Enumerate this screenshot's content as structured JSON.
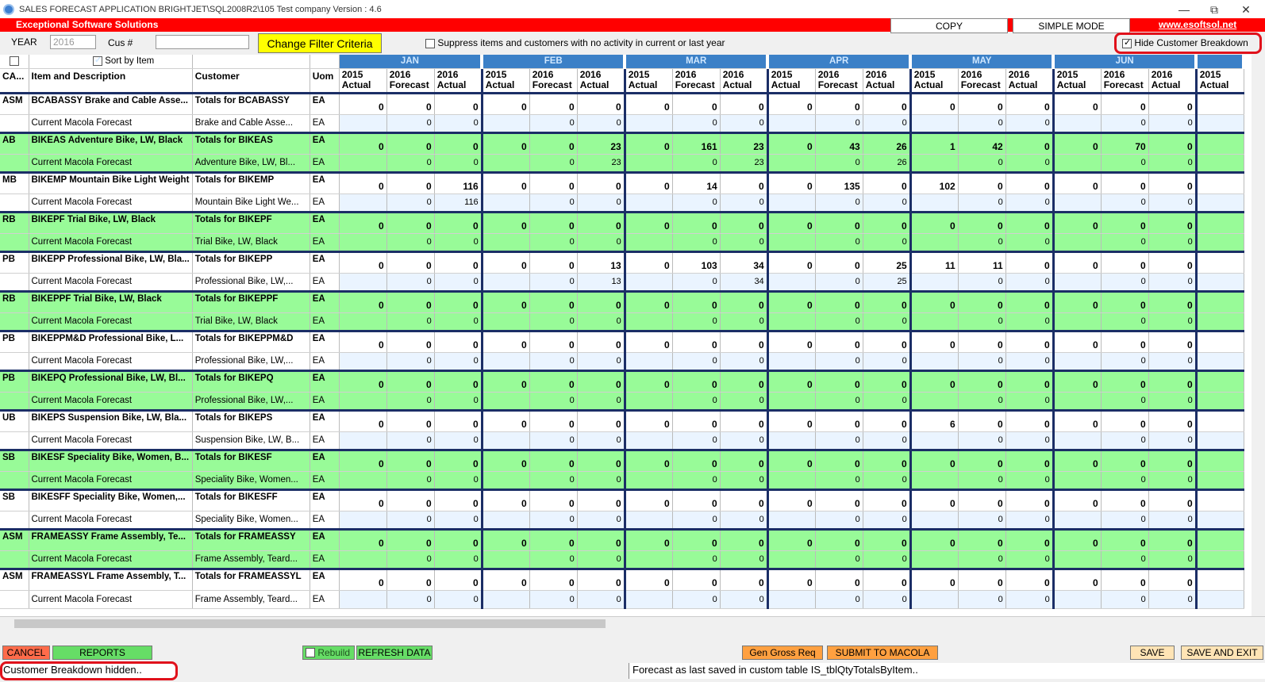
{
  "window": {
    "title": "SALES FORECAST APPLICATION  BRIGHTJET\\SQL2008R2\\105     Test company  Version : 4.6",
    "controls": [
      "—",
      "⧉",
      "✕"
    ]
  },
  "header": {
    "brand": "Exceptional Software Solutions",
    "copy_label": "COPY",
    "simple_mode_label": "SIMPLE MODE",
    "url": "www.esoftsol.net",
    "brand_color": "#ff0000"
  },
  "filters": {
    "year_label": "YEAR",
    "year_value": "2016",
    "cus_label": "Cus #",
    "cus_value": "",
    "change_filter_label": "Change Filter Criteria",
    "suppress_label": "Suppress items and customers with no activity in current or last year",
    "hide_breakdown_label": "Hide Customer Breakdown"
  },
  "grid": {
    "sort_label": "Sort by Item",
    "months": [
      "JAN",
      "FEB",
      "MAR",
      "APR",
      "MAY",
      "JUN"
    ],
    "col_headers": [
      "CA...",
      "Item and Description",
      "Customer",
      "Uom"
    ],
    "sub_headers": [
      "2015 Actual",
      "2016 Forecast",
      "2016 Actual"
    ],
    "last_sub_header": "2015 Actual",
    "fc_desc": "Current Macola Forecast",
    "rows": [
      {
        "ca": "ASM",
        "item": "BCABASSY Brake and Cable Asse...",
        "cust": "Totals for BCABASSY",
        "fcust": "Brake and Cable Asse...",
        "uom": "EA",
        "green": false,
        "t": [
          "0",
          "0",
          "0",
          "0",
          "0",
          "0",
          "0",
          "0",
          "0",
          "0",
          "0",
          "0",
          "0",
          "0",
          "0",
          "0",
          "0",
          "0"
        ],
        "f": [
          "",
          "0",
          "0",
          "",
          "0",
          "0",
          "",
          "0",
          "0",
          "",
          "0",
          "0",
          "",
          "0",
          "0",
          "",
          "0",
          "0"
        ]
      },
      {
        "ca": "AB",
        "item": "BIKEAS Adventure Bike, LW, Black",
        "cust": "Totals for BIKEAS",
        "fcust": "Adventure Bike, LW, Bl...",
        "uom": "EA",
        "green": true,
        "t": [
          "0",
          "0",
          "0",
          "0",
          "0",
          "23",
          "0",
          "161",
          "23",
          "0",
          "43",
          "26",
          "1",
          "42",
          "0",
          "0",
          "70",
          "0"
        ],
        "f": [
          "",
          "0",
          "0",
          "",
          "0",
          "23",
          "",
          "0",
          "23",
          "",
          "0",
          "26",
          "",
          "0",
          "0",
          "",
          "0",
          "0"
        ]
      },
      {
        "ca": "MB",
        "item": "BIKEMP Mountain Bike Light Weight",
        "cust": "Totals for BIKEMP",
        "fcust": "Mountain Bike Light We...",
        "uom": "EA",
        "green": false,
        "t": [
          "0",
          "0",
          "116",
          "0",
          "0",
          "0",
          "0",
          "14",
          "0",
          "0",
          "135",
          "0",
          "102",
          "0",
          "0",
          "0",
          "0",
          "0"
        ],
        "f": [
          "",
          "0",
          "116",
          "",
          "0",
          "0",
          "",
          "0",
          "0",
          "",
          "0",
          "0",
          "",
          "0",
          "0",
          "",
          "0",
          "0"
        ]
      },
      {
        "ca": "RB",
        "item": "BIKEPF Trial Bike, LW, Black",
        "cust": "Totals for BIKEPF",
        "fcust": "Trial Bike, LW, Black",
        "uom": "EA",
        "green": true,
        "t": [
          "0",
          "0",
          "0",
          "0",
          "0",
          "0",
          "0",
          "0",
          "0",
          "0",
          "0",
          "0",
          "0",
          "0",
          "0",
          "0",
          "0",
          "0"
        ],
        "f": [
          "",
          "0",
          "0",
          "",
          "0",
          "0",
          "",
          "0",
          "0",
          "",
          "0",
          "0",
          "",
          "0",
          "0",
          "",
          "0",
          "0"
        ]
      },
      {
        "ca": "PB",
        "item": "BIKEPP Professional Bike, LW, Bla...",
        "cust": "Totals for BIKEPP",
        "fcust": "Professional Bike, LW,...",
        "uom": "EA",
        "green": false,
        "t": [
          "0",
          "0",
          "0",
          "0",
          "0",
          "13",
          "0",
          "103",
          "34",
          "0",
          "0",
          "25",
          "11",
          "11",
          "0",
          "0",
          "0",
          "0"
        ],
        "f": [
          "",
          "0",
          "0",
          "",
          "0",
          "13",
          "",
          "0",
          "34",
          "",
          "0",
          "25",
          "",
          "0",
          "0",
          "",
          "0",
          "0"
        ]
      },
      {
        "ca": "RB",
        "item": "BIKEPPF Trial Bike, LW, Black",
        "cust": "Totals for BIKEPPF",
        "fcust": "Trial Bike, LW, Black",
        "uom": "EA",
        "green": true,
        "t": [
          "0",
          "0",
          "0",
          "0",
          "0",
          "0",
          "0",
          "0",
          "0",
          "0",
          "0",
          "0",
          "0",
          "0",
          "0",
          "0",
          "0",
          "0"
        ],
        "f": [
          "",
          "0",
          "0",
          "",
          "0",
          "0",
          "",
          "0",
          "0",
          "",
          "0",
          "0",
          "",
          "0",
          "0",
          "",
          "0",
          "0"
        ]
      },
      {
        "ca": "PB",
        "item": "BIKEPPM&D Professional Bike, L...",
        "cust": "Totals for BIKEPPM&D",
        "fcust": "Professional Bike, LW,...",
        "uom": "EA",
        "green": false,
        "t": [
          "0",
          "0",
          "0",
          "0",
          "0",
          "0",
          "0",
          "0",
          "0",
          "0",
          "0",
          "0",
          "0",
          "0",
          "0",
          "0",
          "0",
          "0"
        ],
        "f": [
          "",
          "0",
          "0",
          "",
          "0",
          "0",
          "",
          "0",
          "0",
          "",
          "0",
          "0",
          "",
          "0",
          "0",
          "",
          "0",
          "0"
        ]
      },
      {
        "ca": "PB",
        "item": "BIKEPQ Professional Bike, LW, Bl...",
        "cust": "Totals for BIKEPQ",
        "fcust": "Professional Bike, LW,...",
        "uom": "EA",
        "green": true,
        "t": [
          "0",
          "0",
          "0",
          "0",
          "0",
          "0",
          "0",
          "0",
          "0",
          "0",
          "0",
          "0",
          "0",
          "0",
          "0",
          "0",
          "0",
          "0"
        ],
        "f": [
          "",
          "0",
          "0",
          "",
          "0",
          "0",
          "",
          "0",
          "0",
          "",
          "0",
          "0",
          "",
          "0",
          "0",
          "",
          "0",
          "0"
        ]
      },
      {
        "ca": "UB",
        "item": "BIKEPS Suspension Bike, LW, Bla...",
        "cust": "Totals for BIKEPS",
        "fcust": "Suspension Bike, LW, B...",
        "uom": "EA",
        "green": false,
        "t": [
          "0",
          "0",
          "0",
          "0",
          "0",
          "0",
          "0",
          "0",
          "0",
          "0",
          "0",
          "0",
          "6",
          "0",
          "0",
          "0",
          "0",
          "0"
        ],
        "f": [
          "",
          "0",
          "0",
          "",
          "0",
          "0",
          "",
          "0",
          "0",
          "",
          "0",
          "0",
          "",
          "0",
          "0",
          "",
          "0",
          "0"
        ]
      },
      {
        "ca": "SB",
        "item": "BIKESF Speciality Bike, Women, B...",
        "cust": "Totals for BIKESF",
        "fcust": "Speciality Bike, Women...",
        "uom": "EA",
        "green": true,
        "t": [
          "0",
          "0",
          "0",
          "0",
          "0",
          "0",
          "0",
          "0",
          "0",
          "0",
          "0",
          "0",
          "0",
          "0",
          "0",
          "0",
          "0",
          "0"
        ],
        "f": [
          "",
          "0",
          "0",
          "",
          "0",
          "0",
          "",
          "0",
          "0",
          "",
          "0",
          "0",
          "",
          "0",
          "0",
          "",
          "0",
          "0"
        ]
      },
      {
        "ca": "SB",
        "item": "BIKESFF Speciality Bike, Women,...",
        "cust": "Totals for BIKESFF",
        "fcust": "Speciality Bike, Women...",
        "uom": "EA",
        "green": false,
        "t": [
          "0",
          "0",
          "0",
          "0",
          "0",
          "0",
          "0",
          "0",
          "0",
          "0",
          "0",
          "0",
          "0",
          "0",
          "0",
          "0",
          "0",
          "0"
        ],
        "f": [
          "",
          "0",
          "0",
          "",
          "0",
          "0",
          "",
          "0",
          "0",
          "",
          "0",
          "0",
          "",
          "0",
          "0",
          "",
          "0",
          "0"
        ]
      },
      {
        "ca": "ASM",
        "item": "FRAMEASSY Frame Assembly, Te...",
        "cust": "Totals for FRAMEASSY",
        "fcust": "Frame Assembly, Teard...",
        "uom": "EA",
        "green": true,
        "t": [
          "0",
          "0",
          "0",
          "0",
          "0",
          "0",
          "0",
          "0",
          "0",
          "0",
          "0",
          "0",
          "0",
          "0",
          "0",
          "0",
          "0",
          "0"
        ],
        "f": [
          "",
          "0",
          "0",
          "",
          "0",
          "0",
          "",
          "0",
          "0",
          "",
          "0",
          "0",
          "",
          "0",
          "0",
          "",
          "0",
          "0"
        ]
      },
      {
        "ca": "ASM",
        "item": "FRAMEASSYL Frame Assembly, T...",
        "cust": "Totals for FRAMEASSYL",
        "fcust": "Frame Assembly, Teard...",
        "uom": "EA",
        "green": false,
        "t": [
          "0",
          "0",
          "0",
          "0",
          "0",
          "0",
          "0",
          "0",
          "0",
          "0",
          "0",
          "0",
          "0",
          "0",
          "0",
          "0",
          "0",
          "0"
        ],
        "f": [
          "",
          "0",
          "0",
          "",
          "0",
          "0",
          "",
          "0",
          "0",
          "",
          "0",
          "0",
          "",
          "0",
          "0",
          "",
          "0",
          "0"
        ]
      }
    ]
  },
  "bottom": {
    "cancel_label": "CANCEL",
    "reports_label": "REPORTS",
    "rebuild_label": "Rebuild",
    "refresh_label": "REFRESH DATA",
    "gen_gross_label": "Gen Gross Req",
    "submit_label": "SUBMIT TO MACOLA",
    "save_label": "SAVE",
    "save_exit_label": "SAVE AND EXIT",
    "status_left": "Customer Breakdown hidden..",
    "status_right": "Forecast as last saved in custom table IS_tblQtyTotalsByItem.."
  },
  "colors": {
    "green_row": "#98fb98",
    "month_header": "#3b80c7",
    "highlight": "#ffff00",
    "cancel": "#ff6b4a",
    "reports": "#66dd66",
    "orange": "#ffa040",
    "save": "#ffe4b5",
    "annotation": "#e0111b"
  }
}
